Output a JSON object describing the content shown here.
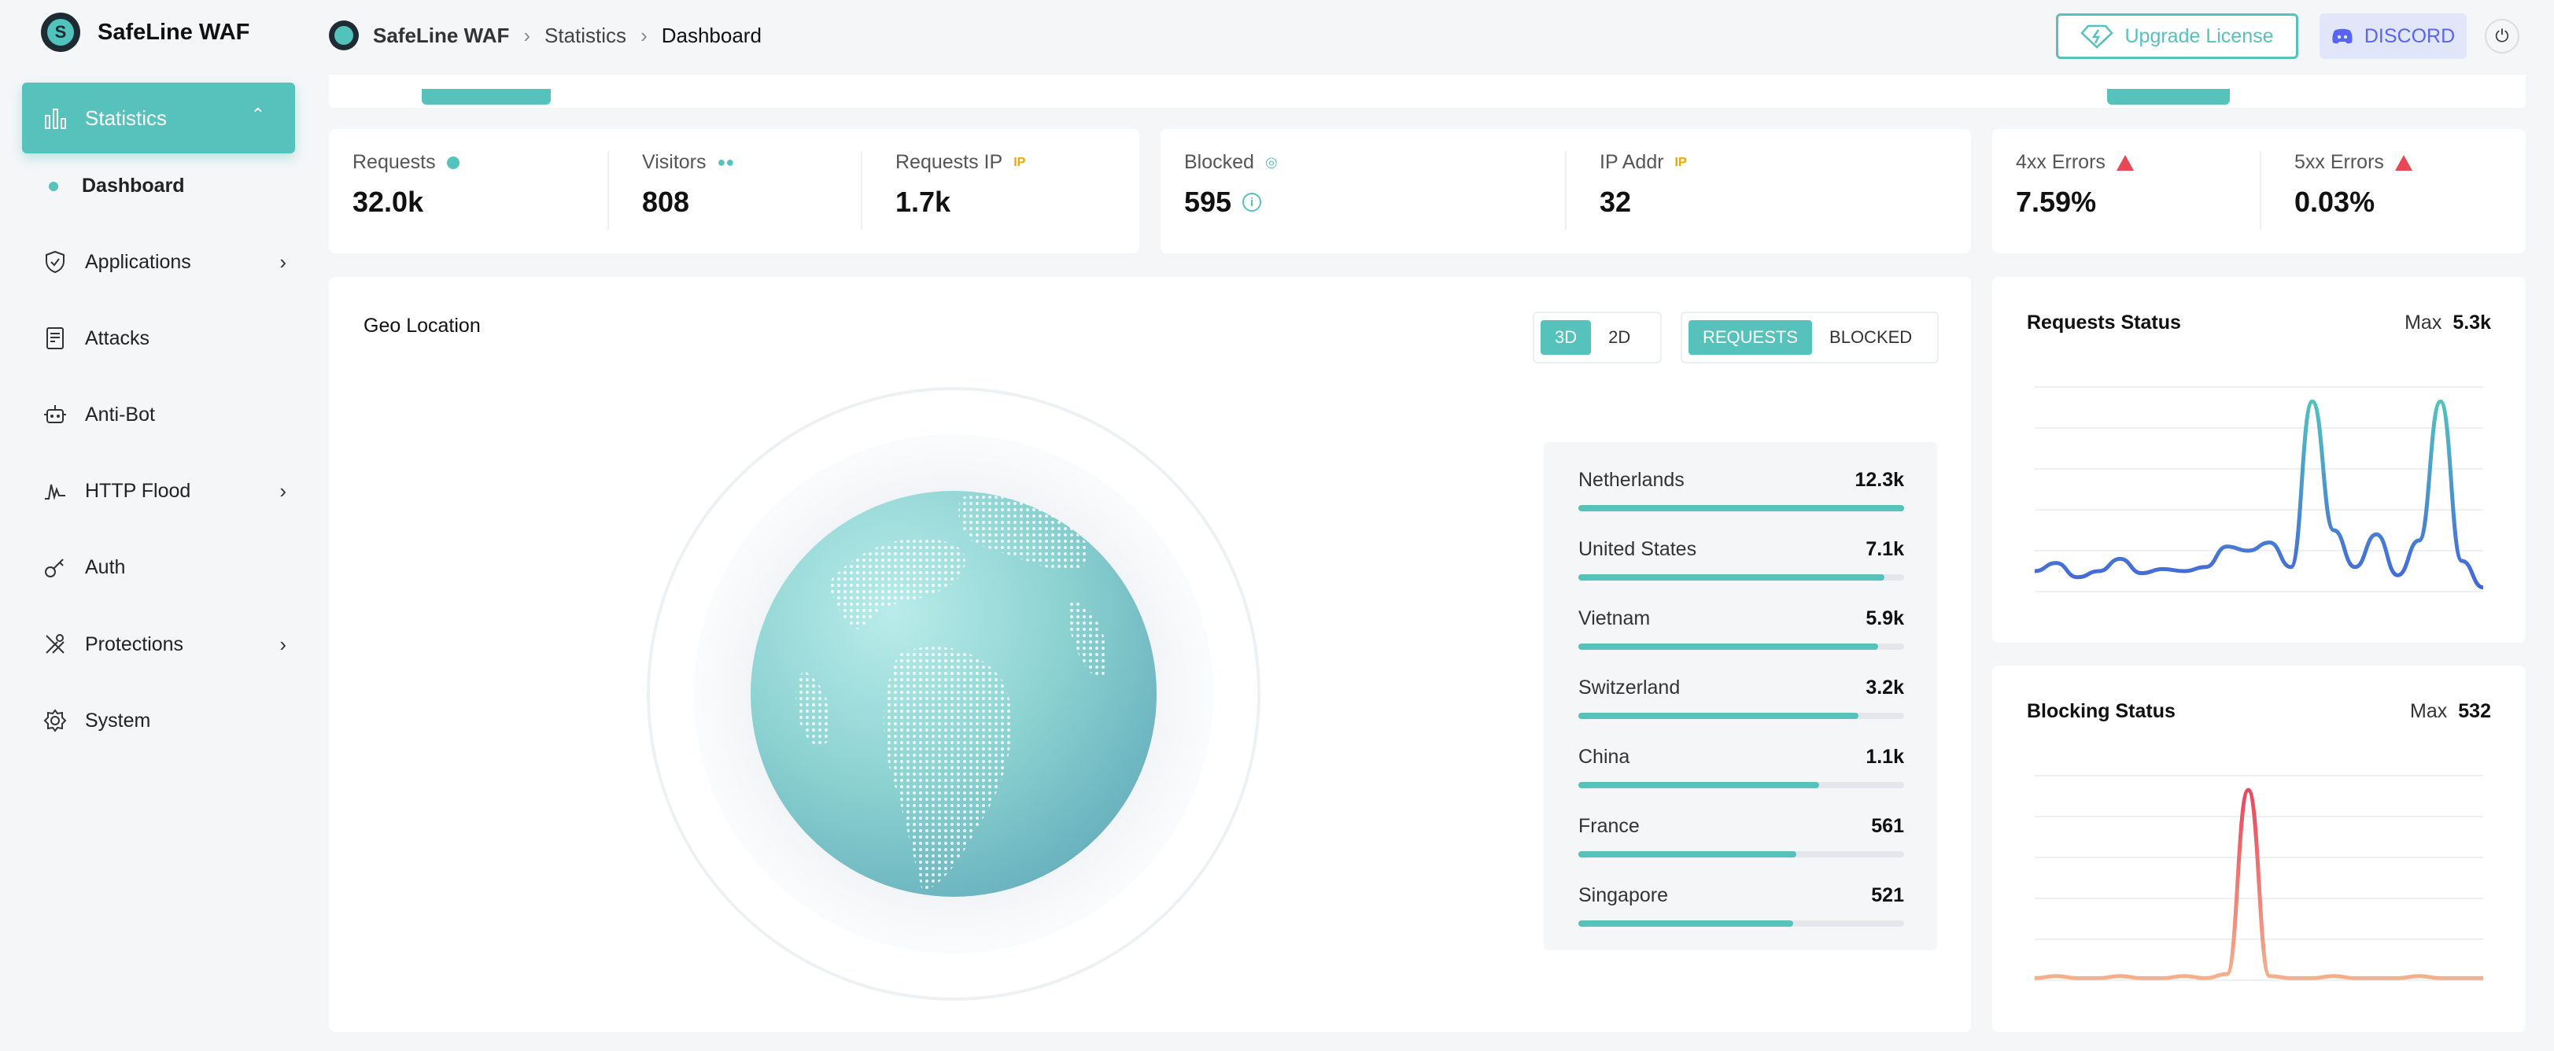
{
  "app": {
    "name": "SafeLine WAF"
  },
  "breadcrumb": {
    "root": "SafeLine WAF",
    "level1": "Statistics",
    "current": "Dashboard"
  },
  "header": {
    "upgrade_label": "Upgrade License",
    "discord_label": "DISCORD"
  },
  "sidebar": {
    "active": {
      "label": "Statistics",
      "sub": "Dashboard"
    },
    "items": [
      {
        "label": "Applications",
        "icon": "shield-icon",
        "chevron": true
      },
      {
        "label": "Attacks",
        "icon": "document-icon",
        "chevron": false
      },
      {
        "label": "Anti-Bot",
        "icon": "robot-icon",
        "chevron": false
      },
      {
        "label": "HTTP Flood",
        "icon": "pulse-icon",
        "chevron": true
      },
      {
        "label": "Auth",
        "icon": "key-icon",
        "chevron": false
      },
      {
        "label": "Protections",
        "icon": "tools-icon",
        "chevron": true
      },
      {
        "label": "System",
        "icon": "gear-icon",
        "chevron": false
      }
    ]
  },
  "stats": {
    "requests": {
      "label": "Requests",
      "value": "32.0k"
    },
    "visitors": {
      "label": "Visitors",
      "value": "808"
    },
    "requests_ip": {
      "label": "Requests IP",
      "tag": "IP",
      "value": "1.7k"
    },
    "blocked": {
      "label": "Blocked",
      "value": "595"
    },
    "ip_addr": {
      "label": "IP Addr",
      "tag": "IP",
      "value": "32"
    },
    "errors_4xx": {
      "label": "4xx Errors",
      "value": "7.59%"
    },
    "errors_5xx": {
      "label": "5xx Errors",
      "value": "0.03%"
    }
  },
  "geo": {
    "title": "Geo Location",
    "view_toggle": [
      "3D",
      "2D"
    ],
    "view_active": "3D",
    "metric_toggle": [
      "REQUESTS",
      "BLOCKED"
    ],
    "metric_active": "REQUESTS",
    "countries": [
      {
        "name": "Netherlands",
        "count": "12.3k",
        "fraction": 1.0
      },
      {
        "name": "United States",
        "count": "7.1k",
        "fraction": 0.94
      },
      {
        "name": "Vietnam",
        "count": "5.9k",
        "fraction": 0.92
      },
      {
        "name": "Switzerland",
        "count": "3.2k",
        "fraction": 0.86
      },
      {
        "name": "China",
        "count": "1.1k",
        "fraction": 0.74
      },
      {
        "name": "France",
        "count": "561",
        "fraction": 0.67
      },
      {
        "name": "Singapore",
        "count": "521",
        "fraction": 0.66
      }
    ]
  },
  "requests_status": {
    "title": "Requests Status",
    "max_label": "Max",
    "max_value": "5.3k",
    "series": [
      0.1,
      0.14,
      0.07,
      0.1,
      0.16,
      0.09,
      0.11,
      0.1,
      0.12,
      0.22,
      0.2,
      0.24,
      0.12,
      0.93,
      0.3,
      0.12,
      0.28,
      0.08,
      0.25,
      0.93,
      0.15,
      0.02
    ]
  },
  "blocking_status": {
    "title": "Blocking Status",
    "max_label": "Max",
    "max_value": "532",
    "series": [
      0.01,
      0.02,
      0.01,
      0.01,
      0.02,
      0.01,
      0.01,
      0.02,
      0.01,
      0.03,
      0.93,
      0.02,
      0.01,
      0.01,
      0.02,
      0.01,
      0.01,
      0.01,
      0.02,
      0.01,
      0.01,
      0.01
    ]
  },
  "colors": {
    "accent": "#57c1bc",
    "line_blue": "#4465d9",
    "line_red": "#e8475f",
    "warning": "#e84855",
    "ip_tag": "#f0a500"
  }
}
